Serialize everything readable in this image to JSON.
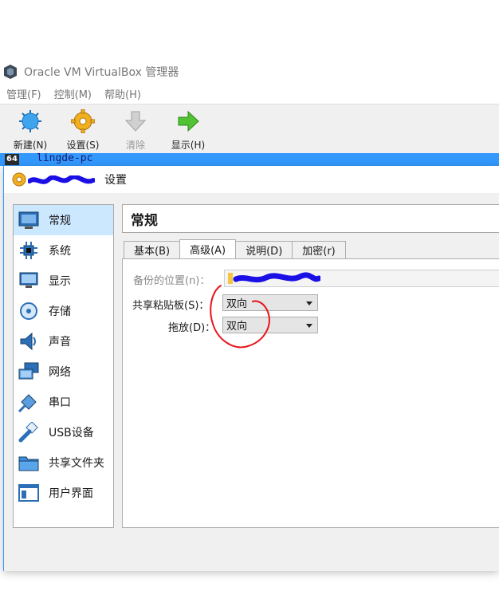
{
  "window": {
    "title": "Oracle VM VirtualBox 管理器"
  },
  "menu": [
    "管理(F)",
    "控制(M)",
    "帮助(H)"
  ],
  "toolbar": {
    "new_label": "新建(N)",
    "settings_label": "设置(S)",
    "discard_label": "清除",
    "show_label": "显示(H)"
  },
  "vm_list": {
    "badge": "64",
    "name": "lingde-pc"
  },
  "dialog": {
    "title_suffix": "设置",
    "sidebar": [
      {
        "label": "常规",
        "icon": "general-icon",
        "selected": true
      },
      {
        "label": "系统",
        "icon": "system-icon"
      },
      {
        "label": "显示",
        "icon": "display-icon"
      },
      {
        "label": "存储",
        "icon": "storage-icon"
      },
      {
        "label": "声音",
        "icon": "audio-icon"
      },
      {
        "label": "网络",
        "icon": "network-icon"
      },
      {
        "label": "串口",
        "icon": "serial-port-icon"
      },
      {
        "label": "USB设备",
        "icon": "usb-icon"
      },
      {
        "label": "共享文件夹",
        "icon": "shared-folder-icon"
      },
      {
        "label": "用户界面",
        "icon": "user-interface-icon"
      }
    ],
    "page_title": "常规",
    "tabs": [
      "基本(B)",
      "高级(A)",
      "说明(D)",
      "加密(r)"
    ],
    "active_tab": "高级(A)",
    "snapshot_label": "备份的位置(n)：",
    "clipboard_label": "共享粘贴板(S)：",
    "clipboard_value": "双向",
    "dragdrop_label": "拖放(D)：",
    "dragdrop_value": "双向"
  },
  "colors": {
    "accent": "#3399ff",
    "selection": "#cce8ff",
    "annotation": "#e8141c",
    "redaction": "#1a10e6"
  }
}
